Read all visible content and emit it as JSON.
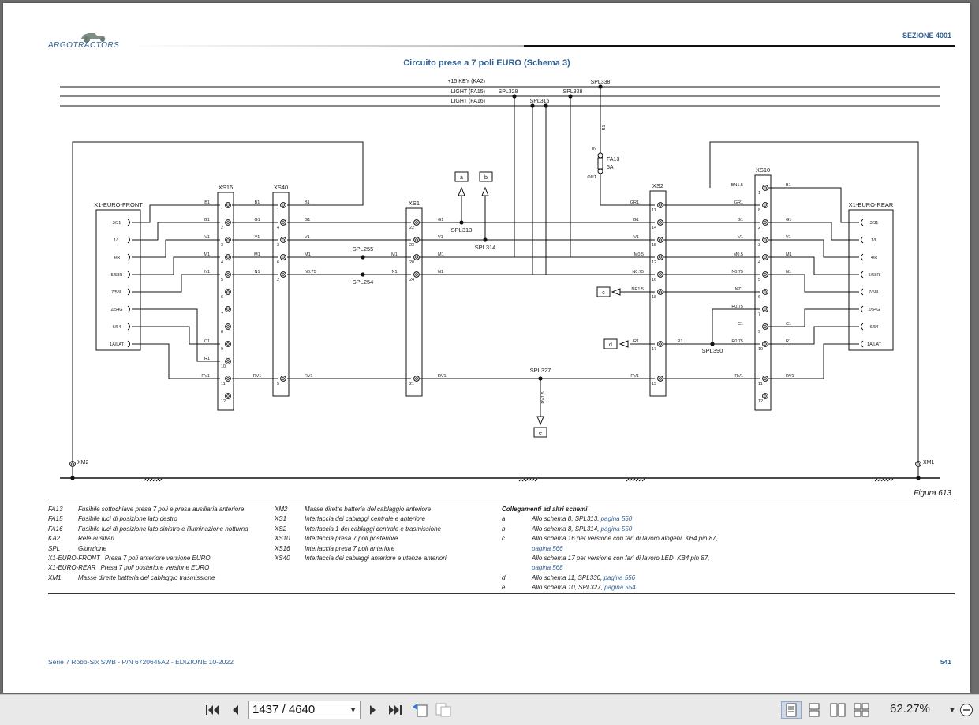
{
  "header": {
    "logo_main": "ARGO",
    "logo_sub": "TRACTORS",
    "section": "SEZIONE 4001"
  },
  "figure": {
    "title": "Circuito prese a 7 poli EURO (Schema 3)",
    "caption": "Figura 613"
  },
  "diagram": {
    "bus": [
      "+15 KEY (KA2)",
      "LIGHT (FA15)",
      "LIGHT (FA16)"
    ],
    "splices": [
      "SPL328",
      "SPL315",
      "SPL328",
      "SPL338",
      "SPL313",
      "SPL314",
      "SPL255",
      "SPL254",
      "SPL327",
      "SPL390"
    ],
    "fuse": {
      "name": "FA13",
      "rating": "5A",
      "in": "IN",
      "out": "OUT",
      "wire": "R1"
    },
    "connectors": {
      "front": {
        "name": "X1-EURO-FRONT",
        "pins": [
          "3/31",
          "1/L",
          "4/R",
          "5/58R",
          "7/58L",
          "2/54G",
          "6/54",
          "1A/LAT"
        ]
      },
      "rear": {
        "name": "X1-EURO-REAR",
        "pins": [
          "3/31",
          "1/L",
          "4/R",
          "5/58R",
          "7/58L",
          "2/54G",
          "6/54",
          "1A/LAT"
        ]
      },
      "xs16": {
        "name": "XS16",
        "pins": [
          "1",
          "2",
          "3",
          "4",
          "5",
          "6",
          "7",
          "8",
          "9",
          "10",
          "11",
          "12"
        ]
      },
      "xs40": {
        "name": "XS40",
        "pins": [
          "1",
          "4",
          "3",
          "6",
          "2",
          "5"
        ]
      },
      "xs1": {
        "name": "XS1",
        "pins": [
          "22",
          "23",
          "20",
          "24",
          "21"
        ]
      },
      "xs2": {
        "name": "XS2",
        "pins": [
          "11",
          "14",
          "15",
          "12",
          "16",
          "18",
          "17",
          "13"
        ]
      },
      "xs10": {
        "name": "XS10",
        "pins": [
          "1",
          "8",
          "2",
          "3",
          "4",
          "5",
          "6",
          "7",
          "9",
          "10",
          "11",
          "12"
        ]
      }
    },
    "grounds": [
      "XM2",
      "XM1"
    ],
    "refs": [
      "a",
      "b",
      "c",
      "d",
      "e"
    ]
  },
  "legend": {
    "col1": [
      [
        "FA13",
        "Fusibile sottochiave presa 7 poli e presa ausiliaria anteriore"
      ],
      [
        "FA15",
        "Fusibile luci di posizione lato destro"
      ],
      [
        "FA16",
        "Fusibile luci di posizione lato sinistro e illuminazione notturna"
      ],
      [
        "KA2",
        "Relé ausiliari"
      ],
      [
        "SPL___",
        "Giunzione"
      ],
      [
        "X1-EURO-FRONT",
        "Presa 7 poli anteriore versione EURO"
      ],
      [
        "X1-EURO-REAR",
        "Presa 7 poli posteriore versione EURO"
      ],
      [
        "XM1",
        "Masse dirette batteria del cablaggio trasmissione"
      ]
    ],
    "col2": [
      [
        "XM2",
        "Masse dirette batteria del cablaggio anteriore"
      ],
      [
        "XS1",
        "Interfaccia dei cablaggi centrale e anteriore"
      ],
      [
        "XS2",
        "Interfaccia 1 dei cablaggi centrale e trasmissione"
      ],
      [
        "XS10",
        "Interfaccia presa 7 poli posteriore"
      ],
      [
        "XS16",
        "Interfaccia presa 7 poli anteriore"
      ],
      [
        "XS40",
        "Interfaccia dei cablaggi anteriore e utenze anteriori"
      ]
    ],
    "links_title": "Collegamenti ad altri schemi",
    "links": [
      [
        "a",
        "Allo schema 8, SPL313, ",
        "pagina 550"
      ],
      [
        "b",
        "Allo schema 8, SPL314, ",
        "pagina 550"
      ],
      [
        "c",
        "Allo schema 16 per versione con fari di lavoro alogeni, KB4 pin 87,",
        "pagina 566"
      ],
      [
        "",
        "Allo schema 17 per versione con fari di lavoro LED, KB4 pin 87,",
        "pagina 568"
      ],
      [
        "d",
        "Allo schema 11, SPL330, ",
        "pagina 556"
      ],
      [
        "e",
        "Allo schema 10, SPL327, ",
        "pagina 554"
      ]
    ]
  },
  "footer": {
    "left": "Serie 7 Robo-Six SWB - P/N 6720645A2 - EDIZIONE 10-2022",
    "page": "541"
  },
  "toolbar": {
    "page_value": "1437 / 4640",
    "zoom": "62.27%",
    "icons": [
      "first-page-icon",
      "prev-page-icon",
      "next-page-icon",
      "last-page-icon",
      "back-view-icon",
      "forward-view-icon",
      "single-page-icon",
      "continuous-icon",
      "facing-icon",
      "continuous-facing-icon",
      "zoom-out-icon"
    ]
  }
}
